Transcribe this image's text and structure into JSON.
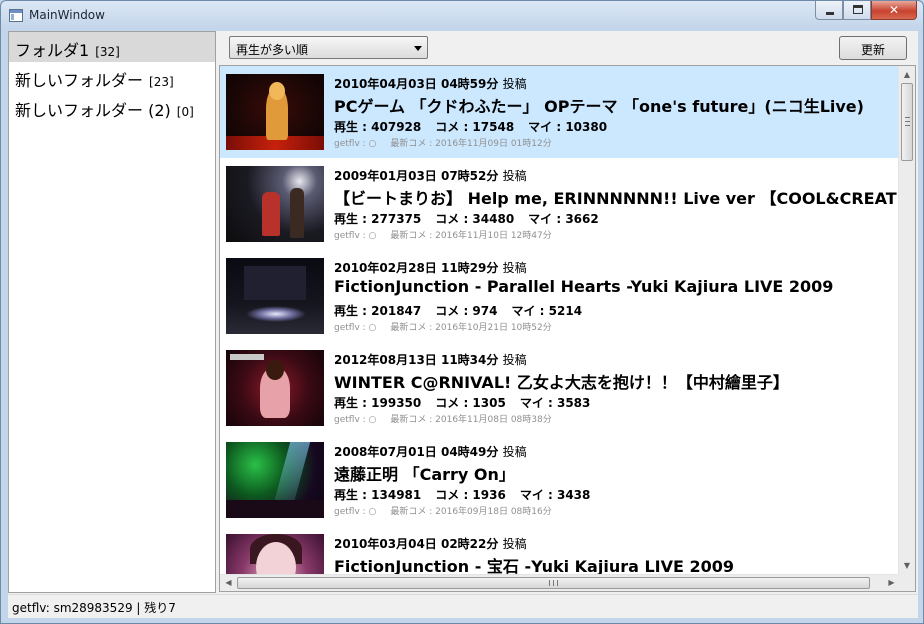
{
  "window": {
    "title": "MainWindow"
  },
  "caption_buttons": {
    "close": "✕"
  },
  "sidebar": {
    "folders": [
      {
        "name": "フォルダ1",
        "count": "[32]",
        "selected": true
      },
      {
        "name": "新しいフォルダー",
        "count": "[23]",
        "selected": false
      },
      {
        "name": "新しいフォルダー (2)",
        "count": "[0]",
        "selected": false
      }
    ]
  },
  "toolbar": {
    "sort_value": "再生が多い順",
    "refresh_label": "更新"
  },
  "videos": [
    {
      "date": "2010年04月03日 04時59分",
      "posted": "投稿",
      "title": "PCゲーム 「クドわふたー」 OPテーマ 「one's future」(ニコ生Live)",
      "plays": "再生 : 407928",
      "comments": "コメ : 17548",
      "mylist": "マイ : 10380",
      "getflv": "getflv : ○",
      "last_comment": "最新コメ : 2016年11月09日 01時12分",
      "selected": true
    },
    {
      "date": "2009年01月03日 07時52分",
      "posted": "投稿",
      "title": "【ビートまりお】 Help me, ERINNNNNN!! Live ver 【COOL&CREATE】",
      "plays": "再生 : 277375",
      "comments": "コメ : 34480",
      "mylist": "マイ : 3662",
      "getflv": "getflv : ○",
      "last_comment": "最新コメ : 2016年11月10日 12時47分",
      "selected": false
    },
    {
      "date": "2010年02月28日 11時29分",
      "posted": "投稿",
      "title": "FictionJunction - Parallel Hearts -Yuki Kajiura LIVE 2009",
      "plays": "再生 : 201847",
      "comments": "コメ : 974",
      "mylist": "マイ : 5214",
      "getflv": "getflv : ○",
      "last_comment": "最新コメ : 2016年10月21日 10時52分",
      "selected": false
    },
    {
      "date": "2012年08月13日 11時34分",
      "posted": "投稿",
      "title": "WINTER C@RNIVAL! 乙女よ大志を抱け！！【中村繪里子】",
      "plays": "再生 : 199350",
      "comments": "コメ : 1305",
      "mylist": "マイ : 3583",
      "getflv": "getflv : ○",
      "last_comment": "最新コメ : 2016年11月08日 08時38分",
      "selected": false
    },
    {
      "date": "2008年07月01日 04時49分",
      "posted": "投稿",
      "title": "遠藤正明 「Carry On」",
      "plays": "再生 : 134981",
      "comments": "コメ : 1936",
      "mylist": "マイ : 3438",
      "getflv": "getflv : ○",
      "last_comment": "最新コメ : 2016年09月18日 08時16分",
      "selected": false
    },
    {
      "date": "2010年03月04日 02時22分",
      "posted": "投稿",
      "title": "FictionJunction - 宝石 -Yuki Kajiura LIVE 2009",
      "plays": "",
      "comments": "",
      "mylist": "",
      "getflv": "",
      "last_comment": "",
      "selected": false
    }
  ],
  "status": {
    "text": "getflv: sm28983529 | 残り7"
  },
  "colors": {
    "selected_row": "#cce8ff",
    "selected_folder": "#d9d9d9",
    "window_frame": "#c3d5ea"
  }
}
